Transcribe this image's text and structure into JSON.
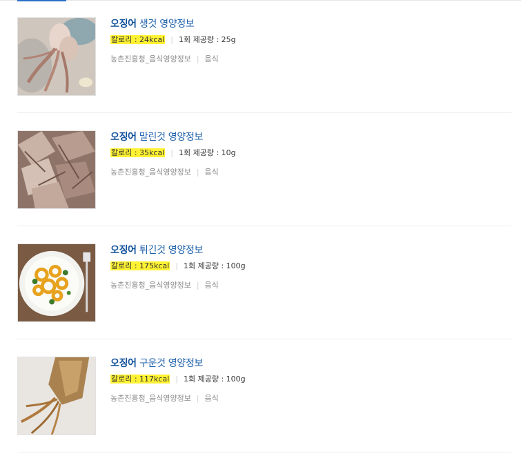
{
  "results": [
    {
      "keyword": "오징어",
      "title_rest": "생것 영양정보",
      "calorie": "칼로리 : 24kcal",
      "serving": "1회 제공량 : 25g",
      "source": "농촌진흥청_음식영양정보",
      "category": "음식",
      "image_icon": "raw-squid-photo"
    },
    {
      "keyword": "오징어",
      "title_rest": "말린것 영양정보",
      "calorie": "칼로리 : 35kcal",
      "serving": "1회 제공량 : 10g",
      "source": "농촌진흥청_음식영양정보",
      "category": "음식",
      "image_icon": "dried-squid-photo"
    },
    {
      "keyword": "오징어",
      "title_rest": "튀긴것 영양정보",
      "calorie": "칼로리 : 175kcal",
      "serving": "1회 제공량 : 100g",
      "source": "농촌진흥청_음식영양정보",
      "category": "음식",
      "image_icon": "fried-squid-rings-photo"
    },
    {
      "keyword": "오징어",
      "title_rest": "구운것 영양정보",
      "calorie": "칼로리 : 117kcal",
      "serving": "1회 제공량 : 100g",
      "source": "농촌진흥청_음식영양정보",
      "category": "음식",
      "image_icon": "grilled-squid-photo"
    }
  ],
  "colors": {
    "title": "#1a5ea8",
    "highlight": "#fff232",
    "source_text": "#8a8a8a"
  }
}
